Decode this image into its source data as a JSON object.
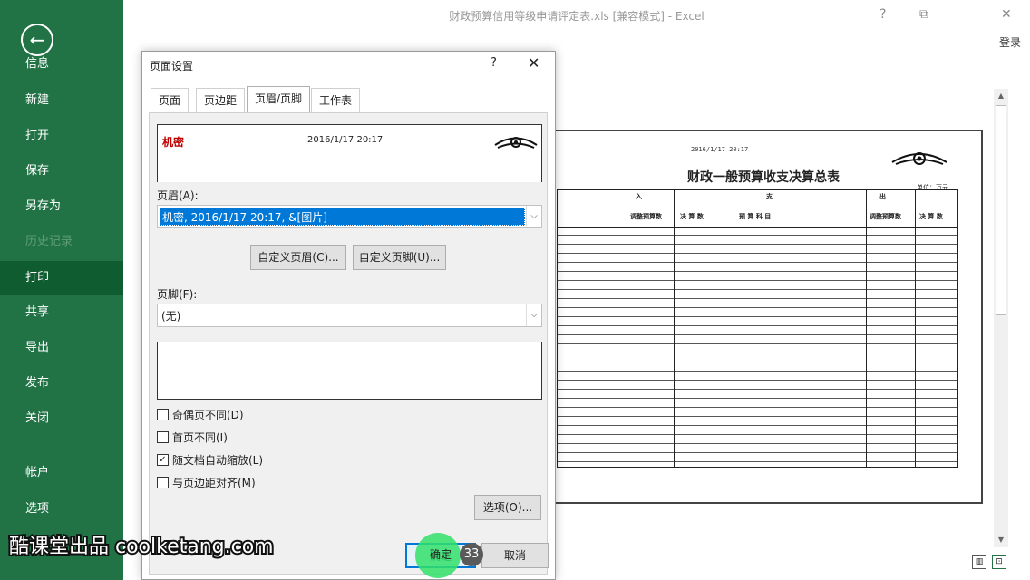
{
  "window": {
    "title": "财政预算信用等级申请评定表.xls  [兼容模式] - Excel",
    "help": "?",
    "login": "登录"
  },
  "sidebar": {
    "items": [
      "信息",
      "新建",
      "打开",
      "保存",
      "另存为",
      "历史记录",
      "打印",
      "共享",
      "导出",
      "发布",
      "关闭",
      "帐户",
      "选项"
    ]
  },
  "preview": {
    "header_date": "2016/1/17 20:17",
    "title": "财政一般预算收支决算总表",
    "unit": "单位：万元",
    "col_in": "入",
    "col_zhi": "支",
    "col_chu": "出",
    "hdr_budget": "调整预算数",
    "hdr_final": "决 算 数",
    "hdr_item": "预    算    科    目"
  },
  "dialog": {
    "title": "页面设置",
    "help": "?",
    "close": "✕",
    "tabs": [
      "页面",
      "页边距",
      "页眉/页脚",
      "工作表"
    ],
    "header_left": "机密",
    "header_center": "2016/1/17 20:17",
    "header_label": "页眉(A):",
    "header_value": "机密, 2016/1/17 20:17, &[图片]",
    "custom_header": "自定义页眉(C)...",
    "custom_footer": "自定义页脚(U)...",
    "footer_label": "页脚(F):",
    "footer_value": "(无)",
    "checkboxes": [
      {
        "label": "奇偶页不同(D)",
        "checked": false
      },
      {
        "label": "首页不同(I)",
        "checked": false
      },
      {
        "label": "随文档自动缩放(L)",
        "checked": true
      },
      {
        "label": "与页边距对齐(M)",
        "checked": false
      }
    ],
    "options": "选项(O)...",
    "ok": "确定",
    "cancel": "取消"
  },
  "overlay": {
    "badge": "33",
    "watermark": "酷课堂出品 coolketang.com"
  }
}
